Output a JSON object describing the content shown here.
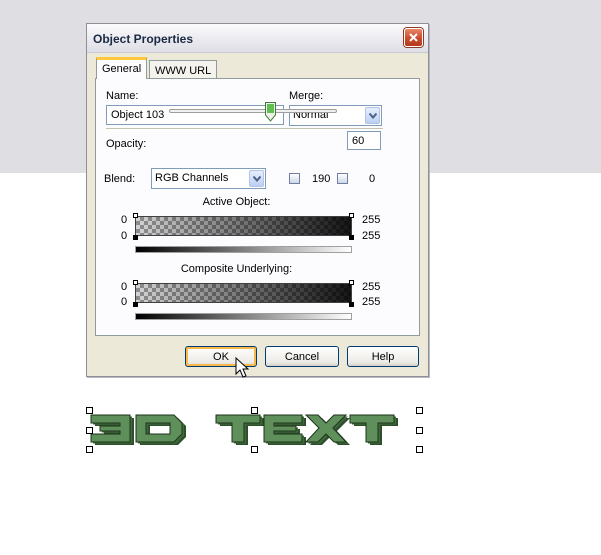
{
  "dialog": {
    "title": "Object Properties",
    "tabs": [
      {
        "label": "General",
        "active": true
      },
      {
        "label": "WWW URL",
        "active": false
      }
    ],
    "name_label": "Name:",
    "name_value": "Object 103",
    "merge_label": "Merge:",
    "merge_value": "Normal",
    "opacity_label": "Opacity:",
    "opacity_value": "60",
    "opacity_level": 0.6,
    "blend_label": "Blend:",
    "blend_value": "RGB Channels",
    "blend_low": "190",
    "blend_high": "0",
    "active_object": {
      "title": "Active Object:",
      "top_left": "0",
      "top_right": "255",
      "bottom_left": "0",
      "bottom_right": "255"
    },
    "composite": {
      "title": "Composite Underlying:",
      "top_left": "0",
      "top_right": "255",
      "bottom_left": "0",
      "bottom_right": "255"
    },
    "buttons": {
      "ok": "OK",
      "cancel": "Cancel",
      "help": "Help"
    }
  },
  "canvas": {
    "object_color": "#5f8f5a",
    "object_highlight": "#8bb384"
  },
  "icons": [
    "close-icon",
    "chevron-down-icon",
    "slider-thumb-icon",
    "spin-icon",
    "mouse-pointer-icon"
  ]
}
